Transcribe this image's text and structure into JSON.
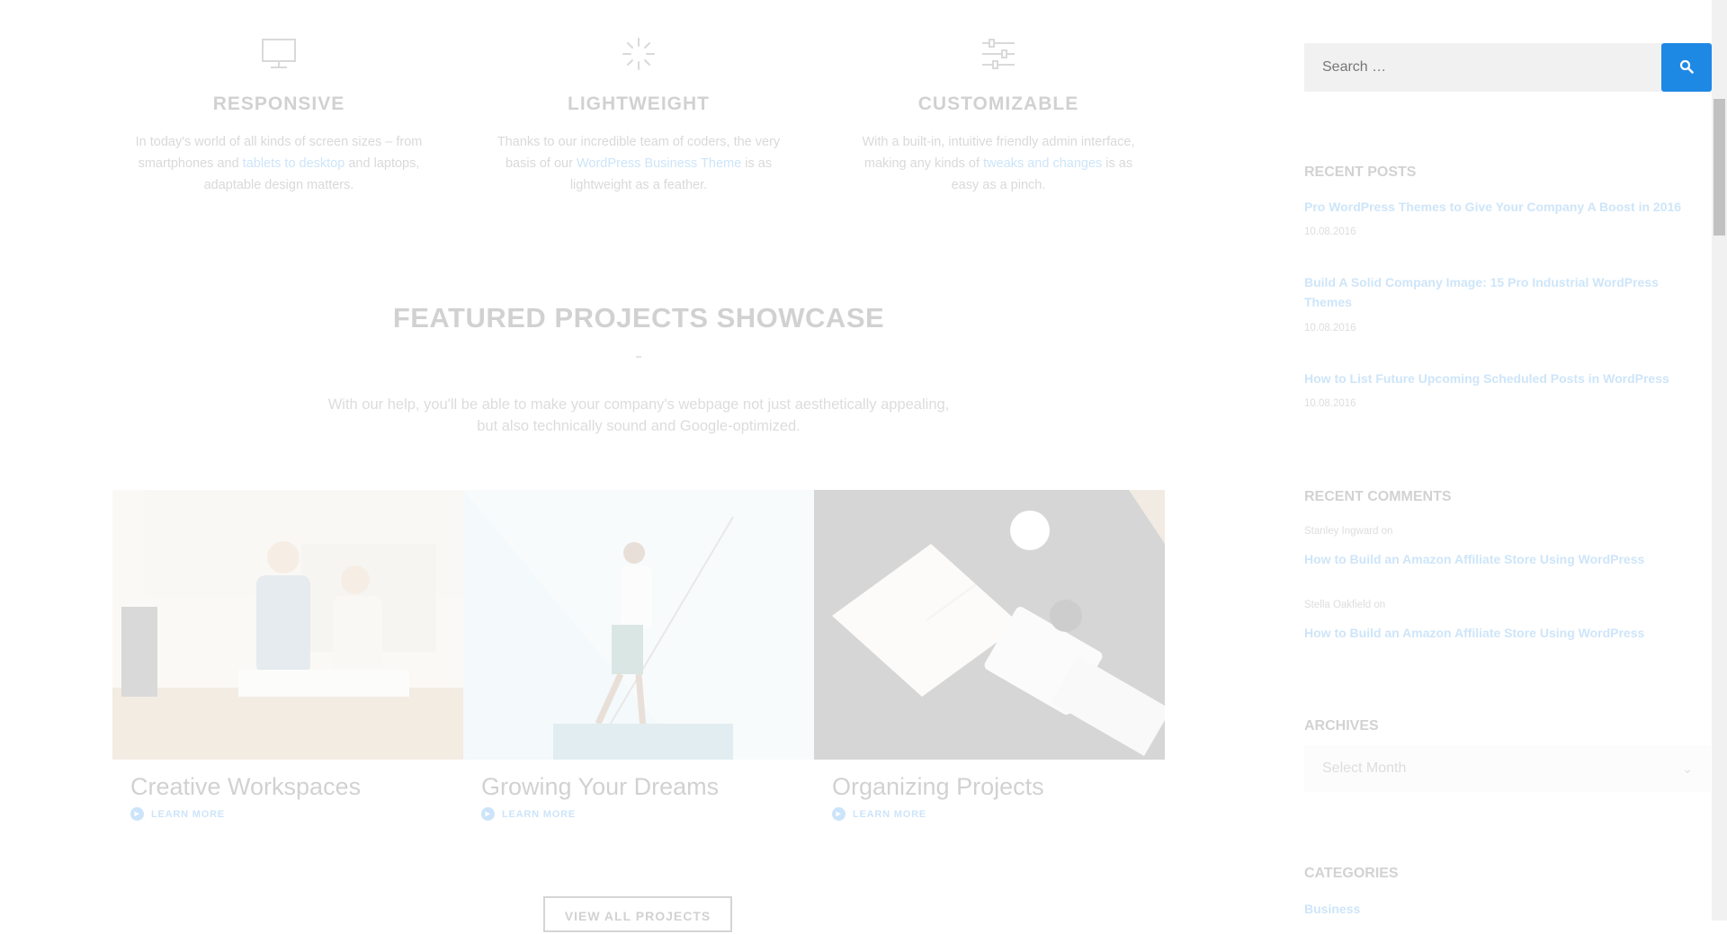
{
  "features": [
    {
      "icon": "monitor-icon",
      "title": "RESPONSIVE",
      "text_before": "In today's world of all kinds of screen sizes – from smartphones and ",
      "link": "tablets to desktop",
      "text_after": " and laptops, adaptable design matters."
    },
    {
      "icon": "spinner-icon",
      "title": "LIGHTWEIGHT",
      "text_before": "Thanks to our incredible team of coders, the very basis of our ",
      "link": "WordPress Business Theme",
      "text_after": " is as lightweight as a feather."
    },
    {
      "icon": "sliders-icon",
      "title": "CUSTOMIZABLE",
      "text_before": "With a built-in, intuitive friendly admin interface, making any kinds of ",
      "link": "tweaks and changes",
      "text_after": " is as easy as a pinch."
    }
  ],
  "showcase": {
    "title": "FEATURED PROJECTS SHOWCASE",
    "description": "With our help, you'll be able to make your company's webpage not just aesthetically appealing, but also technically sound and Google-optimized.",
    "projects": [
      {
        "title": "Creative Workspaces",
        "link": "LEARN MORE"
      },
      {
        "title": "Growing Your Dreams",
        "link": "LEARN MORE"
      },
      {
        "title": "Organizing Projects",
        "link": "LEARN MORE"
      }
    ],
    "view_all": "VIEW ALL PROJECTS"
  },
  "sidebar": {
    "search_placeholder": "Search …",
    "recent_posts": {
      "title": "RECENT POSTS",
      "items": [
        {
          "title": "Pro WordPress Themes to Give Your Company A Boost in 2016",
          "date": "10.08.2016"
        },
        {
          "title": "Build A Solid Company Image: 15 Pro Industrial WordPress Themes",
          "date": "10.08.2016"
        },
        {
          "title": "How to List Future Upcoming Scheduled Posts in WordPress",
          "date": "10.08.2016"
        }
      ]
    },
    "recent_comments": {
      "title": "RECENT COMMENTS",
      "items": [
        {
          "author": "Stanley Ingward on",
          "post": "How to Build an Amazon Affiliate Store Using WordPress"
        },
        {
          "author": "Stella Oakfield on",
          "post": "How to Build an Amazon Affiliate Store Using WordPress"
        }
      ]
    },
    "archives": {
      "title": "ARCHIVES",
      "selected": "Select Month"
    },
    "categories": {
      "title": "CATEGORIES",
      "items": [
        "Business"
      ]
    }
  },
  "colors": {
    "accent": "#1e88e5",
    "input_bg": "#f1f1f1"
  }
}
